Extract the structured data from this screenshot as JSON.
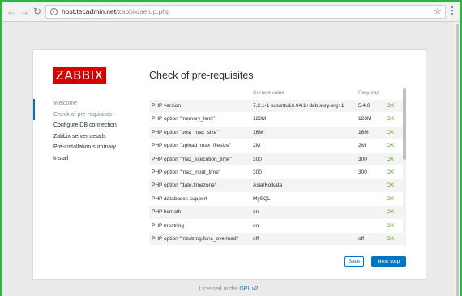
{
  "browser": {
    "url_host": "host.tecadmin.net",
    "url_path": "/zabbix/setup.php",
    "icons": {
      "back": "arrow-left",
      "forward": "arrow-right",
      "reload": "reload",
      "info": "info",
      "star": "star",
      "menu": "vertical-dots"
    }
  },
  "logo": {
    "text": "ZABBIX",
    "color": "#d40000"
  },
  "title": "Check of pre-requisites",
  "steps": [
    {
      "label": "Welcome"
    },
    {
      "label": "Check of pre-requisites"
    },
    {
      "label": "Configure DB connection"
    },
    {
      "label": "Zabbix server details"
    },
    {
      "label": "Pre-installation summary"
    },
    {
      "label": "Install"
    }
  ],
  "table": {
    "headers": {
      "current": "Current value",
      "required": "Required"
    },
    "rows": [
      {
        "name": "PHP version",
        "current": "7.2.1-1+ubuntu16.04.1+deb.sury.org+1",
        "required": "5.4.0",
        "status": "OK"
      },
      {
        "name": "PHP option \"memory_limit\"",
        "current": "128M",
        "required": "128M",
        "status": "OK"
      },
      {
        "name": "PHP option \"post_max_size\"",
        "current": "16M",
        "required": "16M",
        "status": "OK"
      },
      {
        "name": "PHP option \"upload_max_filesize\"",
        "current": "2M",
        "required": "2M",
        "status": "OK"
      },
      {
        "name": "PHP option \"max_execution_time\"",
        "current": "300",
        "required": "300",
        "status": "OK"
      },
      {
        "name": "PHP option \"max_input_time\"",
        "current": "300",
        "required": "300",
        "status": "OK"
      },
      {
        "name": "PHP option \"date.timezone\"",
        "current": "Asia/Kolkata",
        "required": "",
        "status": "OK"
      },
      {
        "name": "PHP databases support",
        "current": "MySQL",
        "required": "",
        "status": "OK"
      },
      {
        "name": "PHP bcmath",
        "current": "on",
        "required": "",
        "status": "OK"
      },
      {
        "name": "PHP mbstring",
        "current": "on",
        "required": "",
        "status": "OK"
      },
      {
        "name": "PHP option \"mbstring.func_overload\"",
        "current": "off",
        "required": "off",
        "status": "OK"
      }
    ]
  },
  "buttons": {
    "back": "Back",
    "next": "Next step"
  },
  "footer": {
    "prefix": "Licensed under ",
    "link": "GPL v2"
  },
  "colors": {
    "accent": "#0074c1",
    "ok": "#59a21b"
  }
}
